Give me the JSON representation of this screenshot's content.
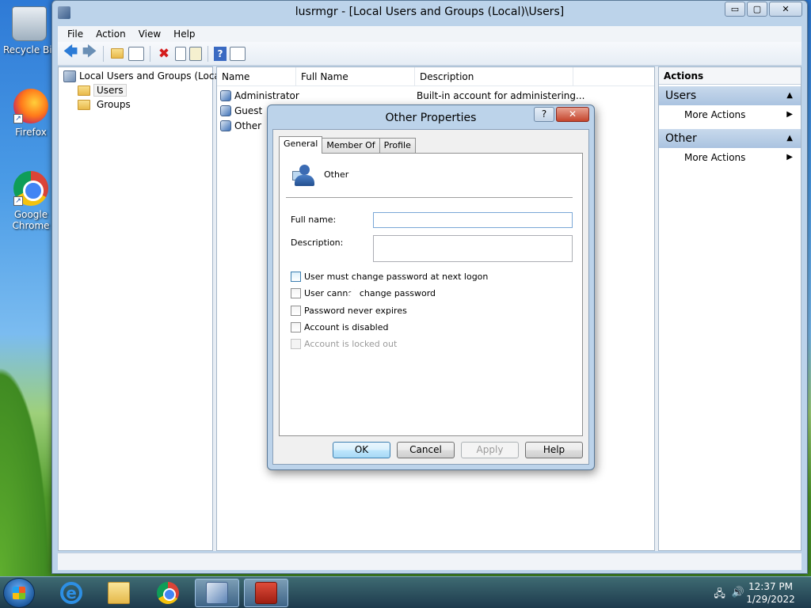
{
  "desktop": {
    "icons": [
      {
        "label": "Recycle Bin",
        "icon": "recycle-bin-icon"
      },
      {
        "label": "Firefox",
        "icon": "firefox-icon"
      },
      {
        "label": "Google Chrome",
        "icon": "chrome-icon"
      }
    ]
  },
  "window": {
    "title": "lusrmgr - [Local Users and Groups (Local)\\Users]",
    "caption": {
      "minimize": "▭",
      "maximize": "▢",
      "close": "✕"
    },
    "menu": [
      "File",
      "Action",
      "View",
      "Help"
    ],
    "tree": {
      "root": "Local Users and Groups (Local)",
      "children": [
        "Users",
        "Groups"
      ],
      "selected": "Users"
    },
    "list": {
      "columns": [
        "Name",
        "Full Name",
        "Description"
      ],
      "rows": [
        {
          "name": "Administrator",
          "full_name": "",
          "description": "Built-in account for administering..."
        },
        {
          "name": "Guest",
          "full_name": "",
          "description": ""
        },
        {
          "name": "Other",
          "full_name": "",
          "description": ""
        }
      ]
    },
    "actions": {
      "header": "Actions",
      "sections": [
        {
          "title": "Users",
          "items": [
            "More Actions"
          ]
        },
        {
          "title": "Other",
          "items": [
            "More Actions"
          ]
        }
      ]
    }
  },
  "dialog": {
    "title": "Other Properties",
    "help_glyph": "?",
    "close_glyph": "✕",
    "tabs": [
      "General",
      "Member Of",
      "Profile"
    ],
    "active_tab": "General",
    "username": "Other",
    "full_name_label": "Full name:",
    "full_name_value": "",
    "description_label": "Description:",
    "description_value": "",
    "checkboxes": [
      {
        "label": "User must change password at next logon",
        "checked": false,
        "enabled": true
      },
      {
        "label": "User cannot change password",
        "checked": false,
        "enabled": true
      },
      {
        "label": "Password never expires",
        "checked": false,
        "enabled": true
      },
      {
        "label": "Account is disabled",
        "checked": false,
        "enabled": true
      },
      {
        "label": "Account is locked out",
        "checked": false,
        "enabled": false
      }
    ],
    "buttons": {
      "ok": "OK",
      "cancel": "Cancel",
      "apply": "Apply",
      "help": "Help"
    }
  },
  "taskbar": {
    "clock_time": "12:37 PM",
    "clock_date": "1/29/2022"
  }
}
